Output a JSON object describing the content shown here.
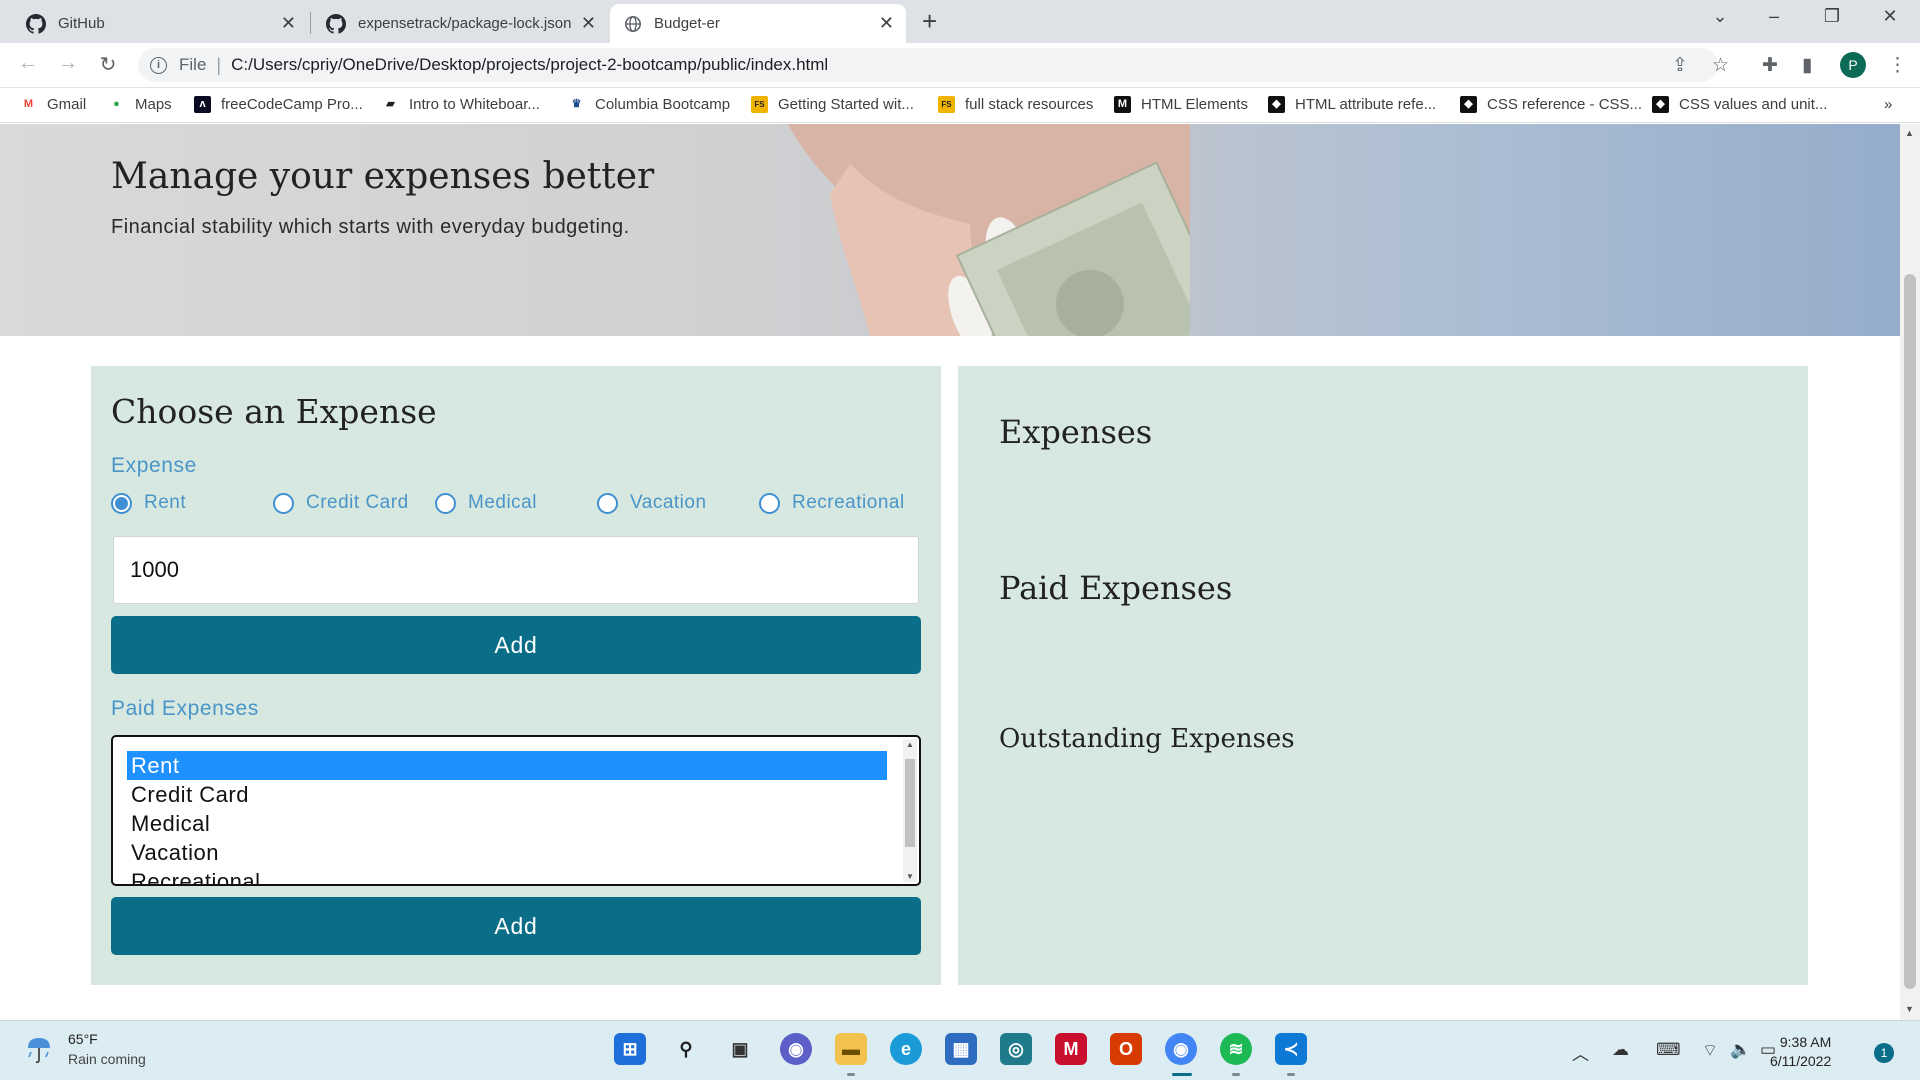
{
  "browser": {
    "tabs": [
      {
        "title": "GitHub",
        "active": false,
        "icon": "github-icon"
      },
      {
        "title": "expensetrack/package-lock.json",
        "active": false,
        "icon": "github-icon"
      },
      {
        "title": "Budget-er",
        "active": true,
        "icon": "globe-icon"
      }
    ],
    "new_tab_glyph": "+",
    "address": {
      "scheme": "File",
      "url": "C:/Users/cpriy/OneDrive/Desktop/projects/project-2-bootcamp/public/index.html"
    },
    "profile_initial": "P",
    "bookmarks": [
      {
        "label": "Gmail",
        "icon": "gmail-icon",
        "color": "#ea4335"
      },
      {
        "label": "Maps",
        "icon": "maps-icon",
        "color": "#34a853"
      },
      {
        "label": "freeCodeCamp Pro...",
        "icon": "freecodecamp-icon",
        "color": "#0a0a23"
      },
      {
        "label": "Intro to Whiteboar...",
        "icon": "book-icon",
        "color": "#222222"
      },
      {
        "label": "Columbia Bootcamp",
        "icon": "columbia-icon",
        "color": "#1d4f91"
      },
      {
        "label": "Getting Started wit...",
        "icon": "fullstack-icon",
        "color": "#f0b400"
      },
      {
        "label": "full stack resources",
        "icon": "fullstack-icon",
        "color": "#f0b400"
      },
      {
        "label": "HTML Elements",
        "icon": "mdn-icon",
        "color": "#111111"
      },
      {
        "label": "HTML attribute refe...",
        "icon": "w3-icon",
        "color": "#111111"
      },
      {
        "label": "CSS reference - CSS...",
        "icon": "w3-icon",
        "color": "#111111"
      },
      {
        "label": "CSS values and unit...",
        "icon": "w3-icon",
        "color": "#111111"
      }
    ],
    "bookmarks_overflow": "»"
  },
  "hero": {
    "title": "Manage your expenses better",
    "subtitle": "Financial stability which starts with everyday budgeting."
  },
  "left_panel": {
    "heading": "Choose an Expense",
    "expense_label": "Expense",
    "radio_options": [
      {
        "label": "Rent",
        "checked": true
      },
      {
        "label": "Credit Card",
        "checked": false
      },
      {
        "label": "Medical",
        "checked": false
      },
      {
        "label": "Vacation",
        "checked": false
      },
      {
        "label": "Recreational",
        "checked": false
      }
    ],
    "amount_value": "1000",
    "add_label": "Add",
    "paid_label": "Paid Expenses",
    "paid_options": [
      {
        "label": "Rent",
        "selected": true
      },
      {
        "label": "Credit Card",
        "selected": false
      },
      {
        "label": "Medical",
        "selected": false
      },
      {
        "label": "Vacation",
        "selected": false
      },
      {
        "label": "Recreational",
        "selected": false
      }
    ],
    "add2_label": "Add"
  },
  "right_panel": {
    "expenses_heading": "Expenses",
    "paid_heading": "Paid Expenses",
    "outstanding_heading": "Outstanding Expenses"
  },
  "taskbar": {
    "weather": {
      "temp": "65°F",
      "desc": "Rain coming"
    },
    "apps": [
      {
        "name": "windows-start-icon",
        "color": "#1e6fd9"
      },
      {
        "name": "search-icon",
        "color": "#222222"
      },
      {
        "name": "task-view-icon",
        "color": "#333333"
      },
      {
        "name": "chat-icon",
        "color": "#5b5fc7"
      },
      {
        "name": "file-explorer-icon",
        "color": "#f2c14e"
      },
      {
        "name": "edge-icon",
        "color": "#1a9bd7"
      },
      {
        "name": "store-icon",
        "color": "#2e6cc0"
      },
      {
        "name": "app-icon",
        "color": "#1f7a8c"
      },
      {
        "name": "mcafee-icon",
        "color": "#c8102e"
      },
      {
        "name": "office-icon",
        "color": "#d83b01"
      },
      {
        "name": "chrome-icon",
        "color": "#4285f4"
      },
      {
        "name": "spotify-icon",
        "color": "#1db954"
      },
      {
        "name": "vscode-icon",
        "color": "#0e78d5"
      }
    ],
    "time": "9:38 AM",
    "date": "6/11/2022",
    "notification_count": "1"
  },
  "colors": {
    "panel_bg": "#d7e8e1",
    "button_bg": "#0b6e89",
    "label_blue": "#4a95c8",
    "selected_option": "#1e90ff"
  }
}
